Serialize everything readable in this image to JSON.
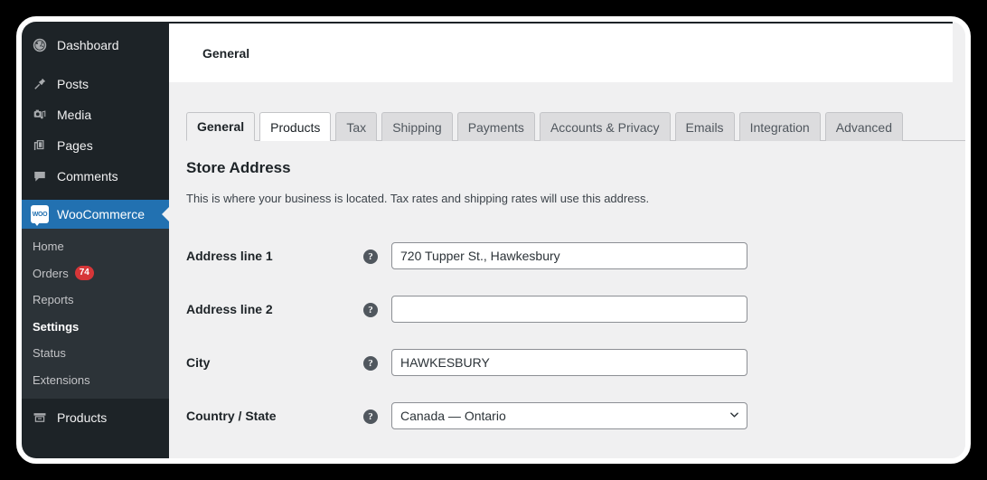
{
  "sidebar": {
    "top_items": [
      {
        "label": "Dashboard",
        "icon": "dashboard-gauge-icon"
      },
      {
        "label": "Posts",
        "icon": "pin-icon"
      },
      {
        "label": "Media",
        "icon": "media-icon"
      },
      {
        "label": "Pages",
        "icon": "pages-icon"
      },
      {
        "label": "Comments",
        "icon": "comment-bubble-icon"
      }
    ],
    "woocommerce": {
      "label": "WooCommerce",
      "icon": "woo-badge-icon",
      "badge_text": "WOO",
      "active": true
    },
    "submenu": [
      {
        "label": "Home",
        "current": false
      },
      {
        "label": "Orders",
        "current": false,
        "count": "74"
      },
      {
        "label": "Reports",
        "current": false
      },
      {
        "label": "Settings",
        "current": true
      },
      {
        "label": "Status",
        "current": false
      },
      {
        "label": "Extensions",
        "current": false
      }
    ],
    "products": {
      "label": "Products",
      "icon": "products-box-icon"
    }
  },
  "header": {
    "title": "General"
  },
  "tabs": [
    {
      "label": "General",
      "state": "active"
    },
    {
      "label": "Products",
      "state": "hovered"
    },
    {
      "label": "Tax",
      "state": "normal"
    },
    {
      "label": "Shipping",
      "state": "normal"
    },
    {
      "label": "Payments",
      "state": "normal"
    },
    {
      "label": "Accounts & Privacy",
      "state": "normal"
    },
    {
      "label": "Emails",
      "state": "normal"
    },
    {
      "label": "Integration",
      "state": "normal"
    },
    {
      "label": "Advanced",
      "state": "normal"
    }
  ],
  "section": {
    "heading": "Store Address",
    "description": "This is where your business is located. Tax rates and shipping rates will use this address."
  },
  "fields": [
    {
      "label": "Address line 1",
      "help": "?",
      "type": "text",
      "value": "720 Tupper St., Hawkesbury",
      "placeholder": ""
    },
    {
      "label": "Address line 2",
      "help": "?",
      "type": "text",
      "value": "",
      "placeholder": ""
    },
    {
      "label": "City",
      "help": "?",
      "type": "text",
      "value": "HAWKESBURY",
      "placeholder": ""
    },
    {
      "label": "Country / State",
      "help": "?",
      "type": "select",
      "value": "Canada — Ontario",
      "options": [
        "Canada — Ontario"
      ]
    }
  ],
  "colors": {
    "sidebar_bg": "#1d2327",
    "submenu_bg": "#2c3338",
    "accent_blue": "#2271b1",
    "badge_red": "#d63638",
    "content_bg": "#f0f0f1"
  }
}
